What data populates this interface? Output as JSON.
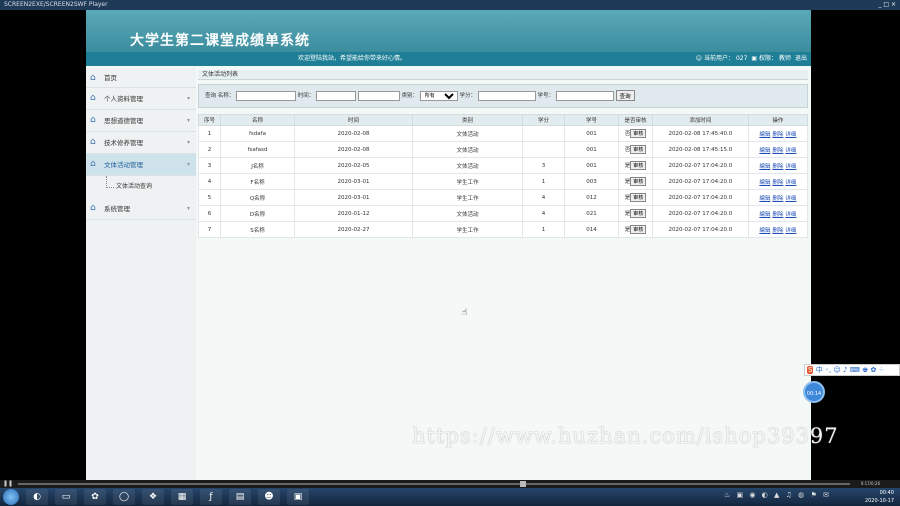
{
  "window": {
    "title": "SCREEN2EXE/SCREEN2SWF Player",
    "controls": "_ □ ×"
  },
  "app": {
    "system_name": "大学生第二课堂成绩单系统",
    "welcome": "欢迎登陆我站，希望能给你带来好心情。",
    "current_user_label": "当前用户：",
    "current_user_value": "027",
    "role_label": "权限：",
    "role_value": "教师",
    "logout_label": "退出"
  },
  "sidebar": {
    "items": [
      {
        "label": "首页"
      },
      {
        "label": "个人资料管理"
      },
      {
        "label": "思想道德管理"
      },
      {
        "label": "技术修养管理"
      },
      {
        "label": "文体活动管理"
      },
      {
        "label": "系统管理"
      }
    ],
    "submenu_item": "文体活动查询"
  },
  "content": {
    "breadcrumb": "文体活动列表",
    "search": {
      "query_label": "查询 名称：",
      "time_label": "时间：",
      "category_label": "类别：",
      "category_value": "所有",
      "credit_label": "学分：",
      "student_label": "学号：",
      "search_button": "查询"
    },
    "table": {
      "headers": [
        "序号",
        "名称",
        "时间",
        "类别",
        "学分",
        "学号",
        "是否审核",
        "添加时间",
        "操作"
      ],
      "audit_button": "审核",
      "ops": [
        "编辑",
        "删除",
        "详细"
      ],
      "rows": [
        [
          "1",
          "fsdafa",
          "2020-02-08",
          "文体活动",
          "",
          "001",
          "否",
          "2020-02-08 17:45:40.0"
        ],
        [
          "2",
          "fsafasd",
          "2020-02-08",
          "文体活动",
          "",
          "001",
          "否",
          "2020-02-08 17:45:15.0"
        ],
        [
          "3",
          "J名称",
          "2020-02-05",
          "文体活动",
          "3",
          "001",
          "是",
          "2020-02-07 17:04:20.0"
        ],
        [
          "4",
          "F名称",
          "2020-03-01",
          "学生工作",
          "1",
          "003",
          "是",
          "2020-02-07 17:04:20.0"
        ],
        [
          "5",
          "Q名称",
          "2020-03-01",
          "学生工作",
          "4",
          "012",
          "是",
          "2020-02-07 17:04:20.0"
        ],
        [
          "6",
          "D名称",
          "2020-01-12",
          "文体活动",
          "4",
          "021",
          "是",
          "2020-02-07 17:04:20.0"
        ],
        [
          "7",
          "S名称",
          "2020-02-27",
          "学生工作",
          "1",
          "014",
          "是",
          "2020-02-07 17:04:20.0"
        ]
      ]
    }
  },
  "overlay": {
    "watermark": "https://www.huzhan.com/ishop39397",
    "ime_bar": "中 ◦, ☺ ♪ ⌨ ♚ ✿ ⁘",
    "ime_ball": "00:14"
  },
  "player": {
    "time": "0:17/0:26"
  },
  "taskbar": {
    "clock_time": "00:40",
    "clock_date": "2020-10-17",
    "apps": [
      "◐",
      "▭",
      "✿",
      "◯",
      "❖",
      "▦",
      "ƒ",
      "▤",
      "☻",
      "▣"
    ]
  }
}
